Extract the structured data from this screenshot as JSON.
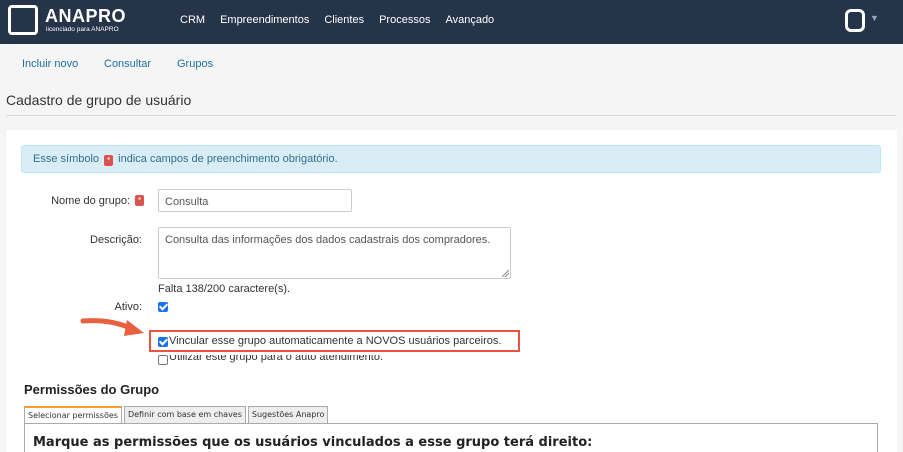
{
  "brand": {
    "name": "ANAPRO",
    "tagline": "licenciado para ANAPRO"
  },
  "nav": [
    "CRM",
    "Empreendimentos",
    "Clientes",
    "Processos",
    "Avançado"
  ],
  "subnav": {
    "incluir": "Incluir novo",
    "consultar": "Consultar",
    "grupos": "Grupos"
  },
  "page": {
    "title": "Cadastro de grupo de usuário"
  },
  "alert": {
    "before": "Esse símbolo",
    "after": "indica campos de preenchimento obrigatório."
  },
  "form": {
    "nome_label": "Nome do grupo:",
    "nome_value": "Consulta",
    "descricao_label": "Descrição:",
    "descricao_value": "Consulta das informações dos dados cadastrais dos compradores.",
    "counter": "Falta 138/200 caractere(s).",
    "ativo_label": "Ativo:",
    "ativo_checked": true,
    "vincular_label": "Vincular esse grupo automaticamente a NOVOS usuários parceiros.",
    "vincular_checked": true,
    "auto_label": "Utilizar este grupo para o auto atendimento.",
    "auto_checked": false
  },
  "permissions": {
    "title": "Permissões do Grupo",
    "tabs": [
      "Selecionar permissões",
      "Definir com base em chaves",
      "Sugestões Anapro"
    ],
    "active_tab": 0,
    "heading": "Marque as permissões que os usuários vinculados a esse grupo terá direito:"
  },
  "colors": {
    "topbar": "#26344a",
    "link": "#1c6ea4",
    "required": "#d9534f",
    "highlight": "#e8543f",
    "arrow": "#e8603f"
  }
}
